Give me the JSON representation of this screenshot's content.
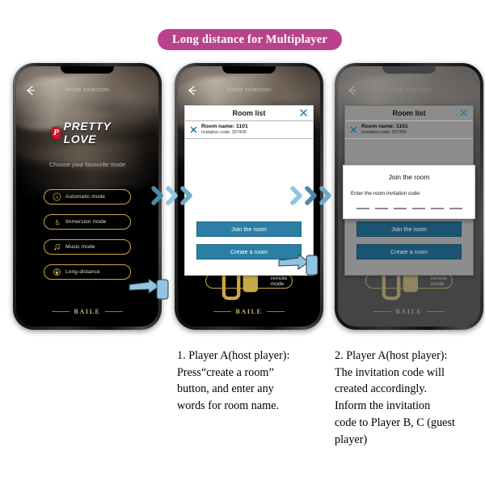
{
  "banner": {
    "text": "Long distance for Multiplayer"
  },
  "phone_app": {
    "nav_title": "Mode selection",
    "back_icon": "back-arrow-icon",
    "brand_mark": "P",
    "brand_name": "PRETTY LOVE",
    "sub_label": "Choose your favourite mode",
    "modes": [
      {
        "label": "Automatic mode",
        "icon": "letter-a-circle-icon"
      },
      {
        "label": "Immersion mode",
        "icon": "hand-pointer-icon"
      },
      {
        "label": "Music mode",
        "icon": "music-note-icon"
      },
      {
        "label": "Long-distance",
        "icon": "globe-lock-icon"
      }
    ],
    "remote_mode": {
      "label": "remote mode",
      "icon": "remote-control-icon"
    },
    "footer_brand": "BAILE"
  },
  "room_list_dialog": {
    "title": "Room list",
    "close_icon": "close-x-icon",
    "row_icon": "close-x-icon",
    "room_name": "Room name: 1101",
    "invitation_code": "Invitation code:  327405",
    "join_button": "Join the room",
    "create_button": "Create a room"
  },
  "join_modal": {
    "title": "Join the room",
    "prompt": "Enter the room invitation code:",
    "code_slots": 6
  },
  "flow_arrows": {
    "icon": "chevron-right-icon",
    "colors": [
      "#4f88a8",
      "#8ec5e2",
      "#6fa9cb"
    ]
  },
  "captions": {
    "step1": "1. Player A(host player):\nPress“create a room”\nbutton, and enter any\nwords for room name.",
    "step2": "2. Player A(host player):\nThe invitation code will\ncreated accordingly.\nInform the invitation\ncode to Player B, C (guest\nplayer)"
  },
  "colors": {
    "banner_bg": "#b8438c",
    "gold": "#c9a84c",
    "action_blue": "#2b7fa4",
    "hand_blue": "#8ec5e2"
  }
}
